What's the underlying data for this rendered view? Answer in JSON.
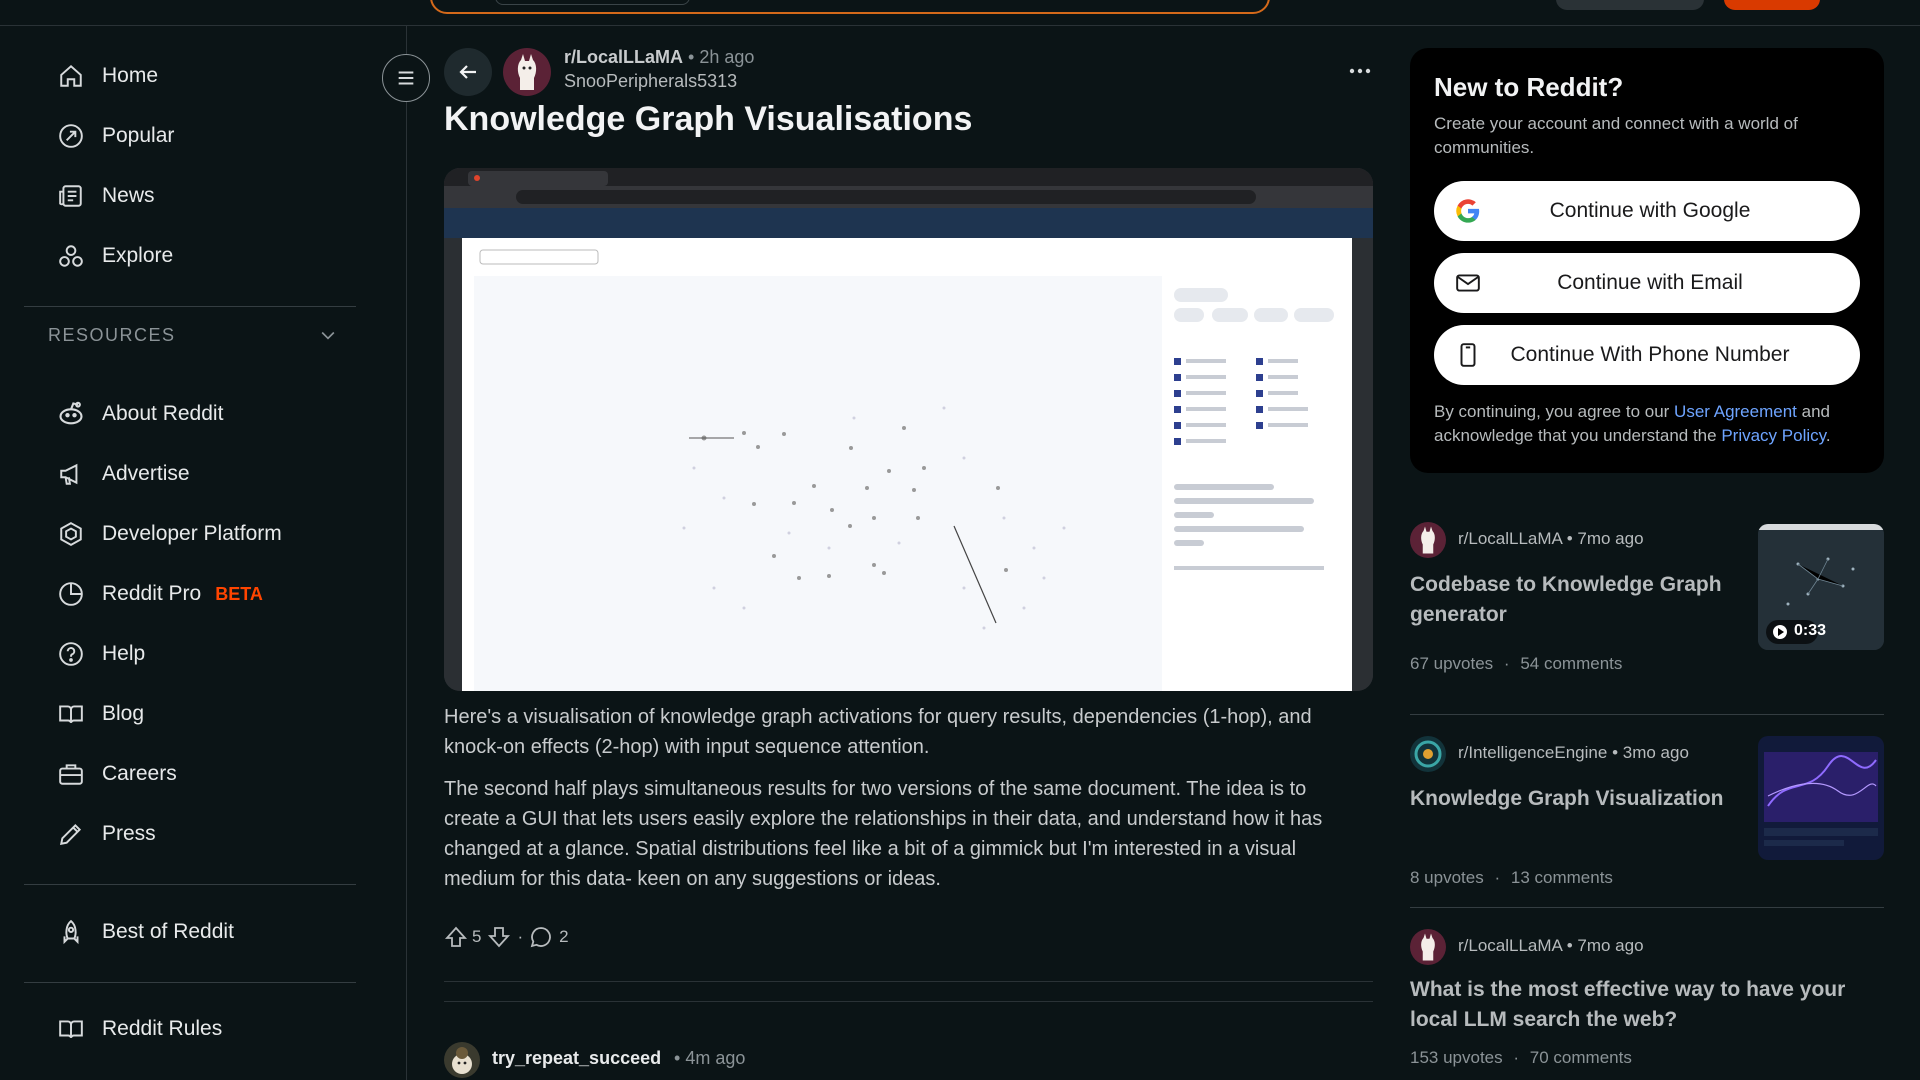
{
  "sidebar": {
    "main_items": [
      {
        "label": "Home",
        "icon": "home-icon"
      },
      {
        "label": "Popular",
        "icon": "popular-icon"
      },
      {
        "label": "News",
        "icon": "news-icon"
      },
      {
        "label": "Explore",
        "icon": "explore-icon"
      }
    ],
    "resources_label": "RESOURCES",
    "resource_items": [
      {
        "label": "About Reddit",
        "icon": "reddit-alien-icon"
      },
      {
        "label": "Advertise",
        "icon": "megaphone-icon"
      },
      {
        "label": "Developer Platform",
        "icon": "developer-platform-icon"
      },
      {
        "label": "Reddit Pro",
        "icon": "reddit-pro-icon",
        "badge": "BETA"
      },
      {
        "label": "Help",
        "icon": "help-icon"
      },
      {
        "label": "Blog",
        "icon": "blog-icon"
      },
      {
        "label": "Careers",
        "icon": "briefcase-icon"
      },
      {
        "label": "Press",
        "icon": "pen-icon"
      }
    ],
    "bottom_items": [
      {
        "label": "Best of Reddit",
        "icon": "rocket-icon"
      },
      {
        "label": "Reddit Rules",
        "icon": "rules-book-icon"
      }
    ]
  },
  "post": {
    "subreddit": "r/LocalLLaMA",
    "separator": "•",
    "time": "2h ago",
    "author": "SnooPeripherals5313",
    "more": "•••",
    "title": "Knowledge Graph Visualisations",
    "body": [
      "Here's a visualisation of knowledge graph activations for query results, dependencies (1-hop), and knock-on effects (2-hop) with input sequence attention.",
      "The second half plays simultaneous results for two versions of the same document. The idea is to create a GUI that lets users easily explore the relationships in their data, and understand how it has changed at a glance. Spatial distributions feel like a bit of a gimmick but I'm interested in a visual medium for this data- keen on any suggestions or ideas."
    ],
    "upvotes": "5",
    "dot": "·",
    "comments": "2"
  },
  "comment": {
    "author": "try_repeat_succeed",
    "separator": "•",
    "time": "4m ago"
  },
  "signup": {
    "title": "New to Reddit?",
    "description": "Create your account and connect with a world of communities.",
    "google": "Continue with Google",
    "email": "Continue with Email",
    "phone": "Continue With Phone Number",
    "legal_prefix": "By continuing, you agree to our ",
    "user_agreement": "User Agreement",
    "legal_mid": " and acknowledge that you understand the ",
    "privacy_policy": "Privacy Policy",
    "legal_suffix": "."
  },
  "related": [
    {
      "subreddit": "r/LocalLLaMA",
      "time": "7mo ago",
      "title": "Codebase to Knowledge Graph generator",
      "upvotes": "67 upvotes",
      "comments": "54 comments",
      "video_duration": "0:33"
    },
    {
      "subreddit": "r/IntelligenceEngine",
      "time": "3mo ago",
      "title": "Knowledge Graph Visualization",
      "upvotes": "8 upvotes",
      "comments": "13 comments"
    },
    {
      "subreddit": "r/LocalLLaMA",
      "time": "7mo ago",
      "title": "What is the most effective way to have your local LLM search the web?",
      "upvotes": "153 upvotes",
      "comments": "70 comments"
    }
  ],
  "related_separator": "•",
  "stats_separator": "·",
  "colors": {
    "background": "#0b1416",
    "accent_orange": "#ff4500",
    "link_blue": "#6ea4ff",
    "card_black": "#000000"
  }
}
